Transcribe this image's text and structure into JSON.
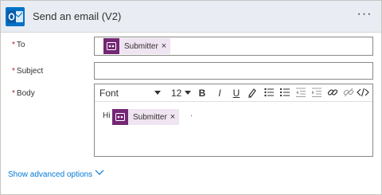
{
  "header": {
    "title": "Send an email (V2)",
    "more_label": "···",
    "icon": "outlook-icon",
    "accent": "#0072c6"
  },
  "fields": {
    "to": {
      "label": "To",
      "token": "Submitter"
    },
    "subject": {
      "label": "Subject",
      "value": ""
    },
    "body": {
      "label": "Body",
      "greeting": "Hi",
      "token": "Submitter",
      "trailing": "·"
    }
  },
  "toolbar": {
    "font": "Font",
    "size": "12",
    "bold": "B",
    "italic": "I",
    "underline": "U",
    "icons": [
      "bold-icon",
      "italic-icon",
      "underline-icon",
      "highlight-icon",
      "bulleted-list-icon",
      "numbered-list-icon",
      "decrease-indent-icon",
      "increase-indent-icon",
      "link-icon",
      "unlink-icon",
      "code-view-icon"
    ]
  },
  "footer": {
    "advanced_label": "Show advanced options"
  },
  "colors": {
    "required": "#a4262c",
    "token_bg": "#efe4f1",
    "token_icon": "#742774",
    "link": "#0078d4"
  }
}
